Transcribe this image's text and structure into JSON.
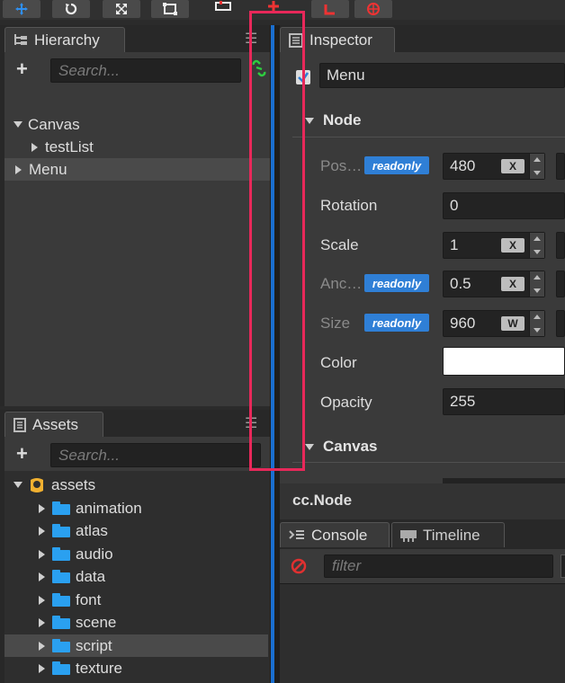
{
  "hierarchy": {
    "tab_label": "Hierarchy",
    "search_placeholder": "Search...",
    "nodes": [
      {
        "label": "Canvas",
        "expanded": true,
        "depth": 0
      },
      {
        "label": "testList",
        "expanded": false,
        "depth": 1
      },
      {
        "label": "Menu",
        "expanded": false,
        "depth": 0,
        "selected": true
      }
    ]
  },
  "assets": {
    "tab_label": "Assets",
    "search_placeholder": "Search...",
    "root": "assets",
    "folders": [
      "animation",
      "atlas",
      "audio",
      "data",
      "font",
      "scene",
      "script",
      "texture"
    ],
    "selected_folder": "script"
  },
  "inspector": {
    "tab_label": "Inspector",
    "node_name": "Menu",
    "active_checked": true,
    "node_section": "Node",
    "badge_text": "readonly",
    "props": {
      "position": {
        "label": "Pos…",
        "x": "480",
        "axis": "X"
      },
      "rotation": {
        "label": "Rotation",
        "value": "0"
      },
      "scale": {
        "label": "Scale",
        "x": "1",
        "axis": "X"
      },
      "anchor": {
        "label": "Anc…",
        "x": "0.5",
        "axis": "X"
      },
      "size": {
        "label": "Size",
        "w": "960",
        "axis": "W"
      },
      "color": {
        "label": "Color",
        "value": "#ffffff"
      },
      "opacity": {
        "label": "Opacity",
        "value": "255"
      }
    },
    "canvas_section": "Canvas",
    "footer": "cc.Node"
  },
  "console": {
    "tab_label": "Console",
    "timeline_tab_label": "Timeline",
    "filter_placeholder": "filter"
  },
  "colors": {
    "accent": "#2f7fd6",
    "folder": "#2aa0f0",
    "highlight_box": "#e8285a",
    "divider": "#1a6fd0"
  }
}
